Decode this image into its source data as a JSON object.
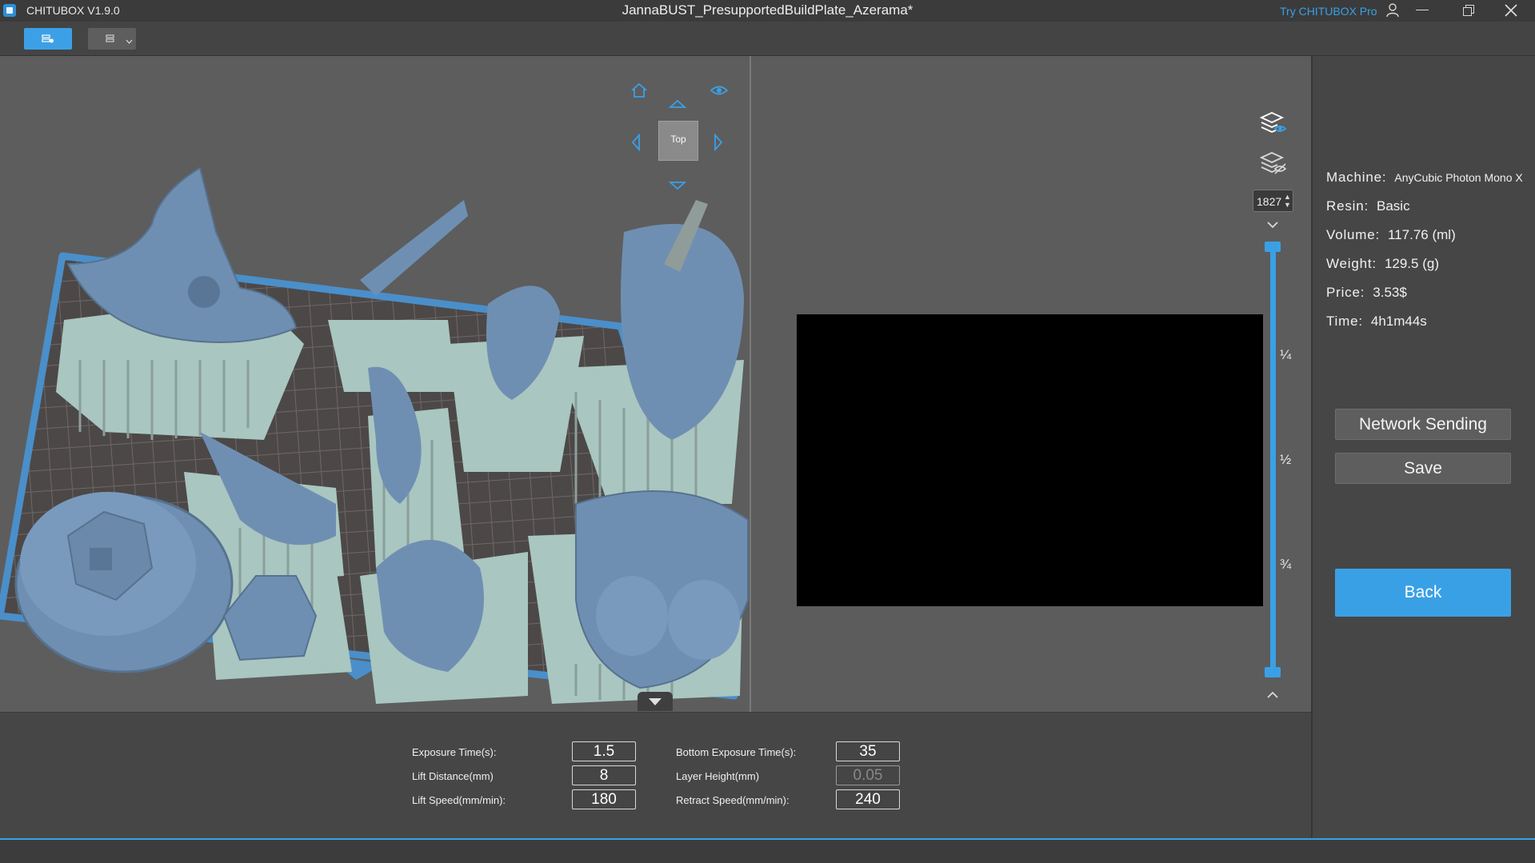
{
  "titlebar": {
    "app_name": "CHITUBOX V1.9.0",
    "document_title": "JannaBUST_PresupportedBuildPlate_Azerama*",
    "try_pro": "Try CHITUBOX Pro",
    "icons": [
      "app-logo-icon",
      "user-icon",
      "minimize-icon",
      "maximize-icon",
      "close-icon"
    ]
  },
  "toolbar": {
    "icons": [
      "slice-icon",
      "model-icon",
      "dropdown-chevron-icon"
    ]
  },
  "viewport": {
    "view_cube_label": "Top",
    "nav_icons": [
      "home-icon",
      "eye-icon",
      "arrow-up-icon",
      "arrow-left-icon",
      "arrow-right-icon",
      "arrow-down-icon"
    ]
  },
  "preview": {
    "layer_value": "1827",
    "slider_marks": [
      "¼",
      "½",
      "¾"
    ],
    "layer_fraction": 1.0,
    "icons": [
      "layer-visible-icon",
      "layer-hidden-icon",
      "chevron-down-icon",
      "chevron-up-icon"
    ]
  },
  "info": {
    "machine_label": "Machine:",
    "machine_value": "AnyCubic Photon Mono X",
    "resin_label": "Resin:",
    "resin_value": "Basic",
    "volume_label": "Volume:",
    "volume_value": "117.76  (ml)",
    "weight_label": "Weight:",
    "weight_value": "129.5  (g)",
    "price_label": "Price:",
    "price_value": "3.53$",
    "time_label": "Time:",
    "time_value": "4h1m44s"
  },
  "actions": {
    "network_sending": "Network Sending",
    "save": "Save",
    "back": "Back"
  },
  "settings": {
    "exposure_time_label": "Exposure Time(s):",
    "exposure_time_value": "1.5",
    "lift_distance_label": "Lift Distance(mm)",
    "lift_distance_value": "8",
    "lift_speed_label": "Lift Speed(mm/min):",
    "lift_speed_value": "180",
    "bottom_exposure_label": "Bottom Exposure Time(s):",
    "bottom_exposure_value": "35",
    "layer_height_label": "Layer Height(mm)",
    "layer_height_value": "0.05",
    "retract_speed_label": "Retract Speed(mm/min):",
    "retract_speed_value": "240"
  },
  "colors": {
    "accent": "#3aa0e6",
    "model": "#6f8fb2",
    "support": "#a9c6c0",
    "plate_border": "#4a8fca"
  }
}
